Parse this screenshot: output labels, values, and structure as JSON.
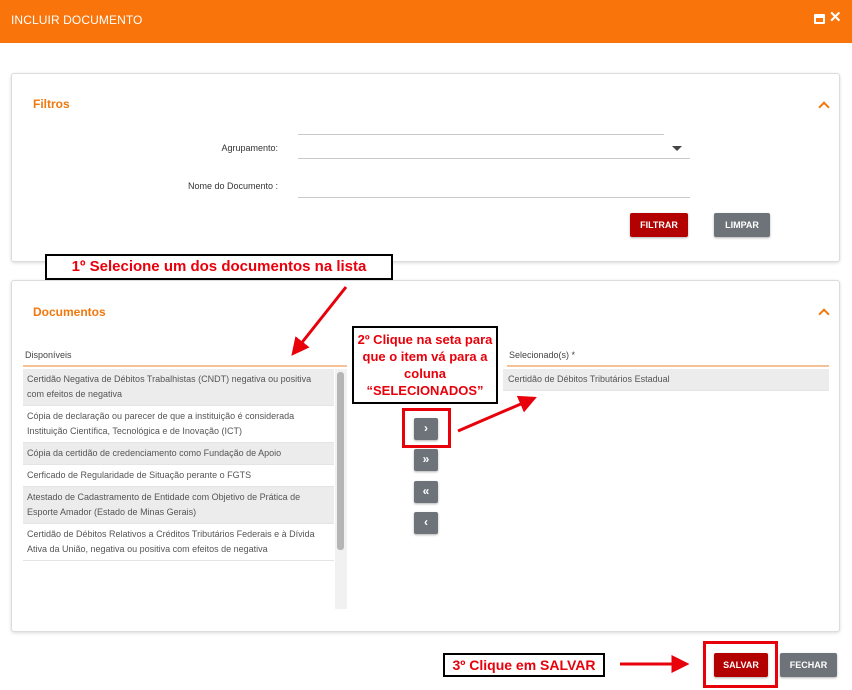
{
  "window": {
    "title": "INCLUIR DOCUMENTO",
    "minimize_icon": "window-icon",
    "close_icon": "close-icon"
  },
  "filtros": {
    "title": "Filtros",
    "agrupamento_label": "Agrupamento:",
    "agrupamento_value": "",
    "nome_label": "Nome do Documento :",
    "nome_value": "",
    "filtrar_label": "FILTRAR",
    "limpar_label": "LIMPAR"
  },
  "documentos": {
    "title": "Documentos",
    "disponiveis_header": "Disponíveis",
    "selecionados_header": "Selecionado(s) *",
    "disponiveis": [
      "Certidão Negativa de Débitos Trabalhistas (CNDT) negativa ou positiva com efeitos de negativa",
      "Cópia de declaração ou parecer  de que a instituição é considerada Instituição Científica, Tecnológica e de Inovação (ICT)",
      "Cópia da certidão de credenciamento como Fundação de Apoio",
      "Cerficado de Regularidade de Situação perante o FGTS",
      "Atestado de Cadastramento de Entidade com Objetivo de Prática de Esporte Amador (Estado de Minas Gerais)",
      "Certidão de Débitos Relativos a Créditos Tributários Federais e à Dívida Ativa da União, negativa ou positiva com efeitos de negativa"
    ],
    "selecionados": [
      "Certidão de Débitos Tributários Estadual"
    ],
    "move_buttons": [
      {
        "symbol": "›",
        "icon": "chevron-right-icon"
      },
      {
        "symbol": "»",
        "icon": "double-chevron-right-icon"
      },
      {
        "symbol": "«",
        "icon": "double-chevron-left-icon"
      },
      {
        "symbol": "‹",
        "icon": "chevron-left-icon"
      }
    ]
  },
  "footer": {
    "salvar_label": "SALVAR",
    "fechar_label": "FECHAR"
  },
  "annotations": {
    "step1": "1º Selecione um dos documentos na lista",
    "step2": "2º Clique na seta para que o item vá para a coluna “SELECIONADOS”",
    "step3": "3º Clique em SALVAR"
  },
  "colors": {
    "brand": "#f9740a",
    "accent_title": "#f0780d",
    "primary_button": "#b30000",
    "secondary_button": "#6d7378",
    "annotation_red": "#e8000b"
  }
}
